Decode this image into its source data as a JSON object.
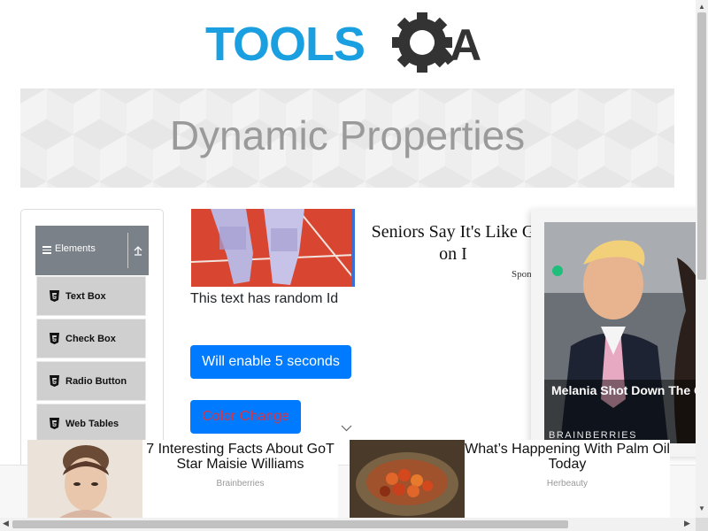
{
  "logo": {
    "text_left": "TOOLS",
    "text_right": "A",
    "colors": {
      "tools": "#1a9fe0",
      "gear": "#333333"
    }
  },
  "page": {
    "title": "Dynamic Properties"
  },
  "sidebar": {
    "group": {
      "label": "Elements",
      "icon": "menu-icon",
      "toggle_icon": "collapse-icon"
    },
    "items": [
      {
        "label": "Text Box",
        "icon": "html5-icon"
      },
      {
        "label": "Check Box",
        "icon": "html5-icon"
      },
      {
        "label": "Radio Button",
        "icon": "html5-icon"
      },
      {
        "label": "Web Tables",
        "icon": "html5-icon"
      }
    ]
  },
  "main": {
    "random_id_text": "This text has random Id",
    "enable_button_label": "Will enable 5 seconds",
    "color_change_button_label": "Color Change",
    "colors": {
      "primary": "#007bff",
      "danger_text": "#dc3545"
    }
  },
  "ad_inline": {
    "headline": "Seniors Say It's Like G on I",
    "source": "Spon"
  },
  "video_ad": {
    "caption": "Melania Shot Down The C About Their Second Chi",
    "brand": "BRAINBERRIES"
  },
  "bottom_ads": [
    {
      "title": "7 Interesting Facts About GoT Star Maisie Williams",
      "source": "Brainberries"
    },
    {
      "title": "What’s Happening With Palm Oil Today",
      "source": "Herbeauty"
    }
  ]
}
